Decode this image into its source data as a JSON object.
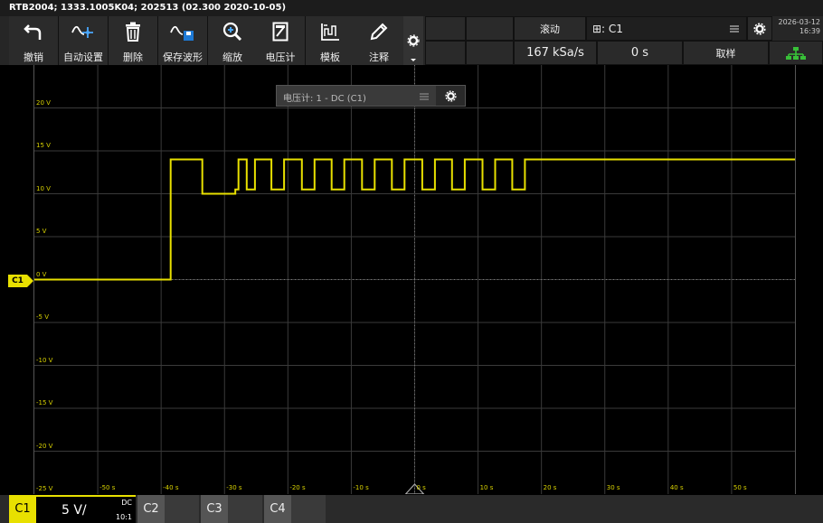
{
  "title_bar": {
    "text": "RTB2004; 1333.1005K04; 202513 (02.300 2020-10-05)"
  },
  "toolbar": {
    "items": [
      {
        "label": "撤销",
        "icon": "undo-icon"
      },
      {
        "label": "自动设置",
        "icon": "autoset-icon"
      },
      {
        "label": "删除",
        "icon": "trash-icon"
      },
      {
        "label": "保存波形",
        "icon": "save-waveform-icon"
      },
      {
        "label": "缩放",
        "icon": "zoom-icon"
      },
      {
        "label": "电压计",
        "icon": "voltmeter-icon"
      },
      {
        "label": "模板",
        "icon": "mask-icon"
      },
      {
        "label": "注释",
        "icon": "pencil-icon"
      }
    ],
    "more_icon": "settings-icon"
  },
  "status": {
    "mode": "滚动",
    "trigger_source": "⊞: C1",
    "sample_rate": "167 kSa/s",
    "time_offset": "0 s",
    "acquire_label": "取样",
    "date": "2026-03-12",
    "time": "16:39"
  },
  "voltmeter_panel": {
    "label": "电压计: 1 - DC (C1)"
  },
  "channel_marker": "C1",
  "bottom_bar": {
    "c1_label": "C1",
    "c1_scale": "5 V/",
    "c1_coupling": "DC",
    "c1_probe": "10:1",
    "c2_label": "C2",
    "c3_label": "C3",
    "c4_label": "C4"
  },
  "chart_data": {
    "type": "line",
    "title": "",
    "xlabel": "",
    "ylabel": "",
    "xlim": [
      -60,
      60
    ],
    "ylim": [
      -25,
      25
    ],
    "grid": true,
    "y_tick_labels": [
      "20 V",
      "15 V",
      "10 V",
      "5 V",
      "0 V",
      "-5 V",
      "-10 V",
      "-15 V",
      "-20 V",
      "-25 V"
    ],
    "x_tick_labels": [
      "-50 s",
      "-40 s",
      "-30 s",
      "-20 s",
      "-10 s",
      "0 s",
      "10 s",
      "20 s",
      "30 s",
      "40 s",
      "50 s"
    ],
    "series": [
      {
        "color": "#e8e000",
        "x": [
          -60,
          -38.5,
          -38.5,
          -33.5,
          -33.5,
          -28.3,
          -28.3,
          -27.8,
          -27.8,
          -26.5,
          -26.5,
          -25.2,
          -25.2,
          -22.6,
          -22.6,
          -20.6,
          -20.6,
          -17.8,
          -17.8,
          -15.8,
          -15.8,
          -13.1,
          -13.1,
          -11.1,
          -11.1,
          -8.3,
          -8.3,
          -6.3,
          -6.3,
          -3.6,
          -3.6,
          -1.6,
          -1.6,
          1.2,
          1.2,
          3.2,
          3.2,
          5.9,
          5.9,
          7.9,
          7.9,
          10.7,
          10.7,
          12.7,
          12.7,
          15.4,
          15.4,
          17.4,
          17.4,
          19.5,
          19.5,
          60
        ],
        "y": [
          0,
          0,
          14,
          14,
          10,
          10,
          10.5,
          10.5,
          14,
          14,
          10.5,
          10.5,
          14,
          14,
          10.5,
          10.5,
          14,
          14,
          10.5,
          10.5,
          14,
          14,
          10.5,
          10.5,
          14,
          14,
          10.5,
          10.5,
          14,
          14,
          10.5,
          10.5,
          14,
          14,
          10.5,
          10.5,
          14,
          14,
          10.5,
          10.5,
          14,
          14,
          10.5,
          10.5,
          14,
          14,
          10.5,
          10.5,
          14,
          14,
          14,
          14
        ]
      }
    ]
  }
}
